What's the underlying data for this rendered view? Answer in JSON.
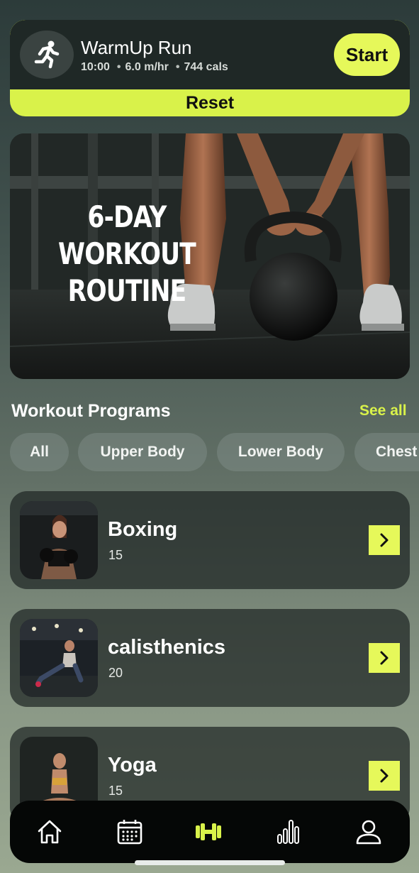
{
  "warmup": {
    "title": "WarmUp Run",
    "duration": "10:00",
    "speed": "6.0 m/hr",
    "calories": "744 cals",
    "separator": "•",
    "start_label": "Start",
    "reset_label": "Reset",
    "icon": "running-person-icon"
  },
  "hero": {
    "line1": "6-DAY",
    "line2": "WORKOUT",
    "line3": "ROUTINE"
  },
  "programs_header": {
    "title": "Workout Programs",
    "see_all": "See all"
  },
  "chips": [
    "All",
    "Upper Body",
    "Lower Body",
    "Chest"
  ],
  "programs": [
    {
      "name": "Boxing",
      "count": "15"
    },
    {
      "name": "calisthenics",
      "count": "20"
    },
    {
      "name": "Yoga",
      "count": "15"
    }
  ],
  "nav": {
    "items": [
      "home-icon",
      "calendar-icon",
      "dumbbell-icon",
      "stats-icon",
      "profile-icon"
    ],
    "active_index": 2
  },
  "colors": {
    "accent": "#e6f85a",
    "card_dark": "#1f2826"
  }
}
